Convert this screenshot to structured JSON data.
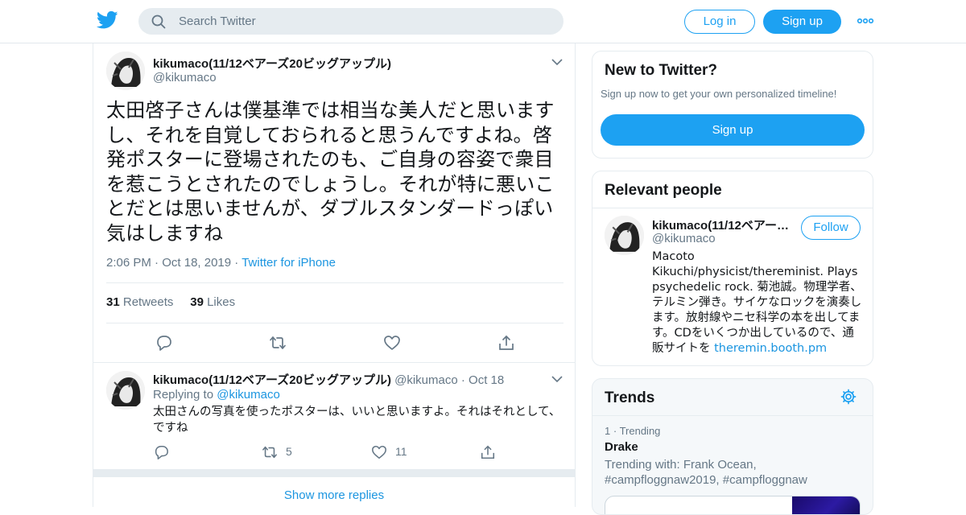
{
  "header": {
    "search_placeholder": "Search Twitter",
    "login_label": "Log in",
    "signup_label": "Sign up",
    "brand_color": "#1da1f2"
  },
  "tweet": {
    "display_name": "kikumaco(11/12ベアーズ20ビッグアップル)",
    "handle": "@kikumaco",
    "text": "太田啓子さんは僕基準では相当な美人だと思います し、それを自覚しておられると思うんですよね。啓発ポスターに登場されたのも、ご自身の容姿で衆目を惹こうとされたのでしょうし。それが特に悪いことだとは思いませんが、ダブルスタンダードっぽい気はしますね",
    "time": "2:06 PM",
    "date": "Oct 18, 2019",
    "source": "Twitter for iPhone",
    "retweets_count": "31",
    "retweets_label": "Retweets",
    "likes_count": "39",
    "likes_label": "Likes"
  },
  "reply": {
    "display_name": "kikumaco(11/12ベアーズ20ビッグアップル)",
    "handle": "@kikumaco",
    "date": "Oct 18",
    "replying_prefix": "Replying to",
    "replying_to": "@kikumaco",
    "text": "太田さんの写真を使ったポスターは、いいと思いますよ。それはそれとして、ですね",
    "retweets": "5",
    "likes": "11"
  },
  "show_more_replies": "Show more replies",
  "new_to_twitter": {
    "title": "New to Twitter?",
    "subtitle": "Sign up now to get your own personalized timeline!",
    "signup_label": "Sign up"
  },
  "relevant_people": {
    "title": "Relevant people",
    "name": "kikumaco(11/12ベアー…",
    "handle": "@kikumaco",
    "follow_label": "Follow",
    "bio": "Macoto Kikuchi/physicist/thereminist. Plays psychedelic rock. 菊池誠。物理学者、テルミン弾き。サイケなロックを演奏します。放射線やニセ科学の本を出してます。CDをいくつか出しているので、通販サイトを",
    "bio_link": "theremin.booth.pm"
  },
  "trends": {
    "title": "Trends",
    "items": [
      {
        "rank": "1",
        "label": "Trending",
        "name": "Drake",
        "with": "Trending with: Frank Ocean, #campfloggnaw2019, #campfloggnaw"
      }
    ]
  }
}
